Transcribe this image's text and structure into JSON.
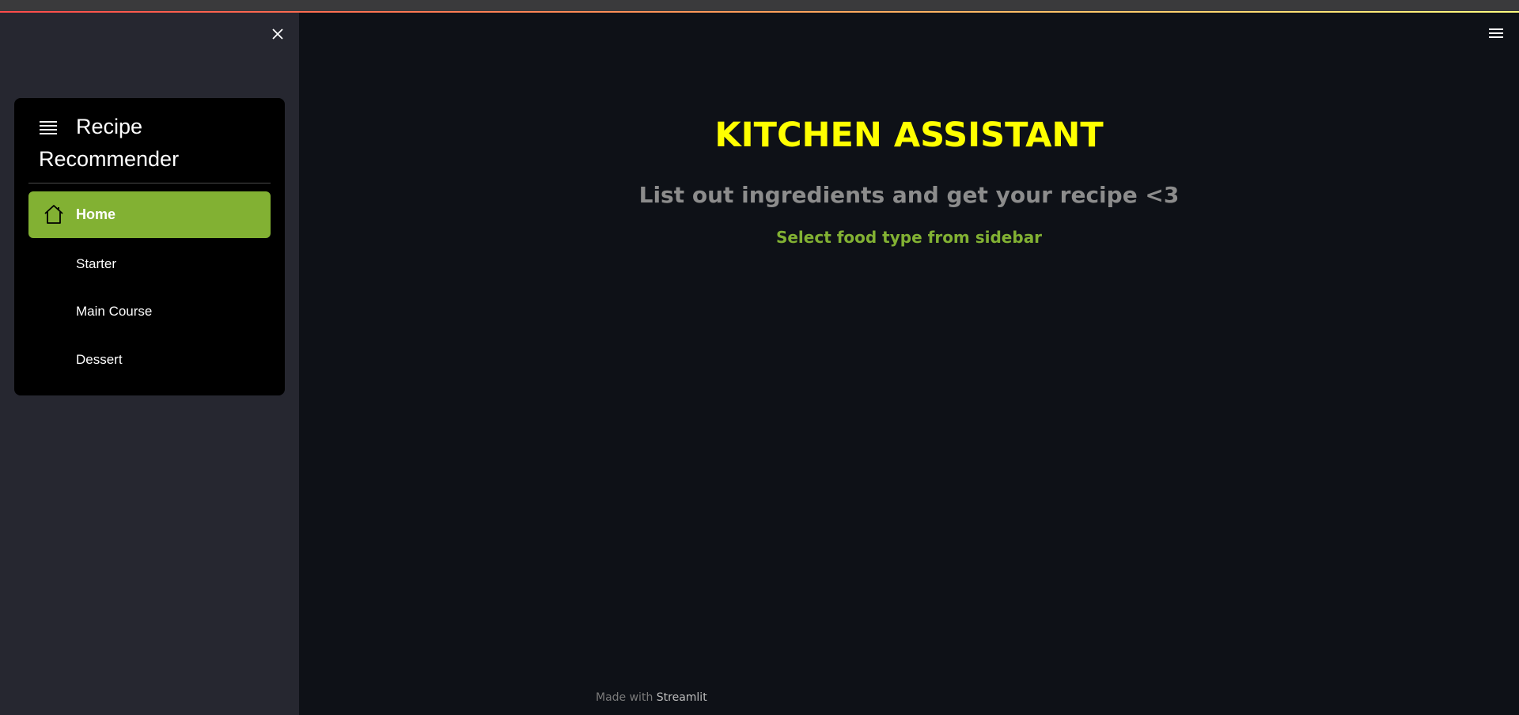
{
  "sidebar": {
    "close_icon": "close-icon",
    "menu_title": "Recipe Recommender",
    "menu_icon": "list-icon",
    "items": [
      {
        "label": "Home",
        "icon": "home-icon",
        "active": true
      },
      {
        "label": "Starter",
        "active": false
      },
      {
        "label": "Main Course",
        "active": false
      },
      {
        "label": "Dessert",
        "active": false
      }
    ],
    "active_color": "#82b133"
  },
  "header": {
    "menu_icon": "hamburger-icon"
  },
  "main": {
    "title": "KITCHEN ASSISTANT",
    "subtitle": "List out ingredients and get your recipe <3",
    "hint": "Select food type from sidebar"
  },
  "footer": {
    "prefix": "Made with",
    "brand": "Streamlit"
  },
  "colors": {
    "background": "#0e1117",
    "sidebar_bg": "#262730",
    "title": "#ffff00",
    "subtitle": "#8c8c8c",
    "hint": "#82b133"
  }
}
